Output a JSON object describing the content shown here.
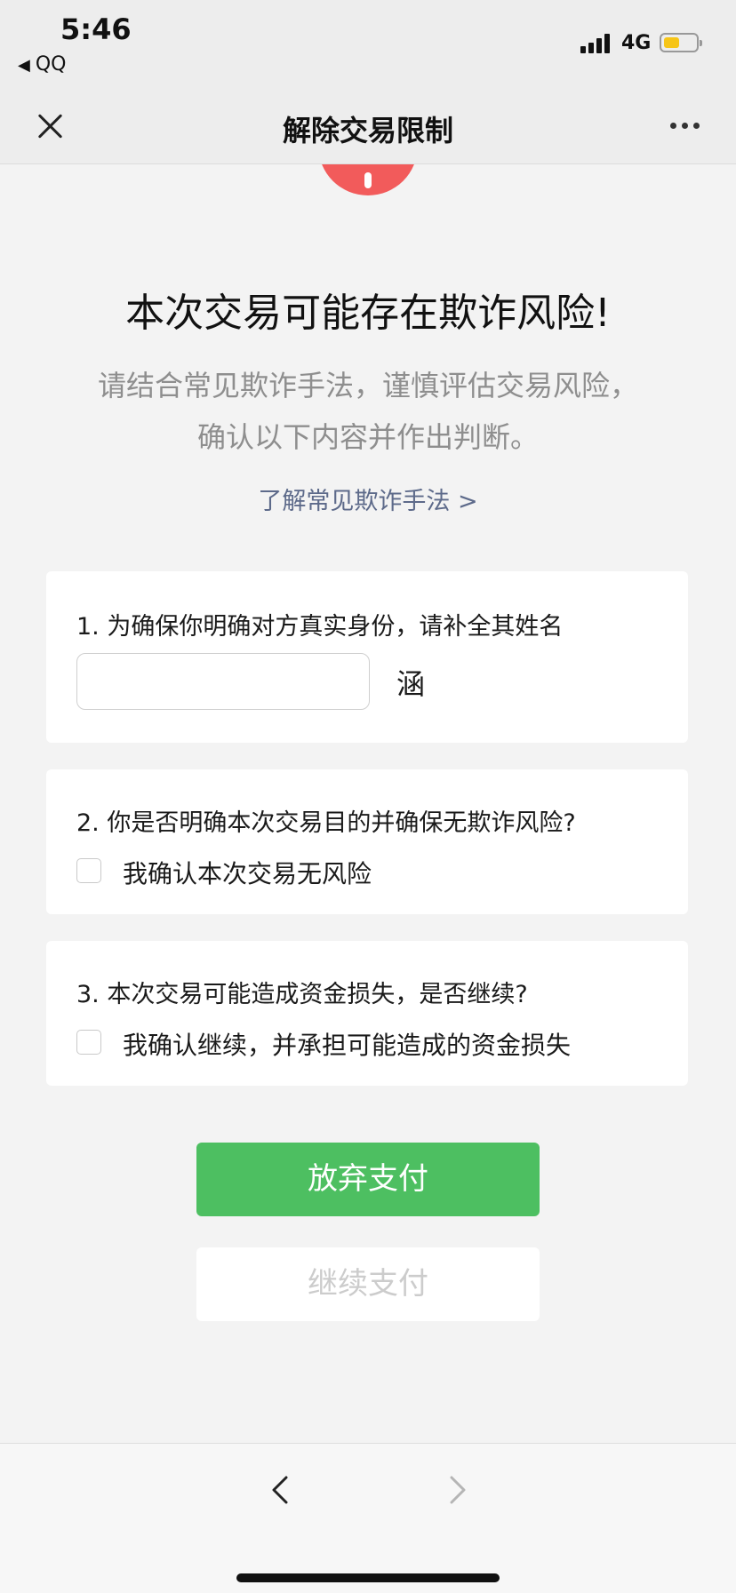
{
  "status_bar": {
    "time": "5:46",
    "back_app": "QQ",
    "network": "4G",
    "battery_level": 0.5
  },
  "nav": {
    "title": "解除交易限制"
  },
  "headline": "本次交易可能存在欺诈风险!",
  "subtitle": "请结合常见欺诈手法，谨慎评估交易风险，确认以下内容并作出判断。",
  "learn_more_link": "了解常见欺诈手法 >",
  "question1": {
    "label": "1. 为确保你明确对方真实身份，请补全其姓名",
    "input_value": "",
    "name_suffix": "涵"
  },
  "question2": {
    "label": "2. 你是否明确本次交易目的并确保无欺诈风险?",
    "checkbox_label": "我确认本次交易无风险",
    "checked": false
  },
  "question3": {
    "label": "3. 本次交易可能造成资金损失，是否继续?",
    "checkbox_label": "我确认继续，并承担可能造成的资金损失",
    "checked": false
  },
  "buttons": {
    "abandon": "放弃支付",
    "continue": "继续支付"
  },
  "colors": {
    "accent_green": "#4dbf61",
    "warning_red": "#f25b5b",
    "link_blue": "#5d6a8a"
  },
  "icons": {
    "close": "close-icon",
    "more": "more-icon",
    "warning": "warning-icon",
    "back": "chevron-left-icon",
    "forward": "chevron-right-icon"
  }
}
